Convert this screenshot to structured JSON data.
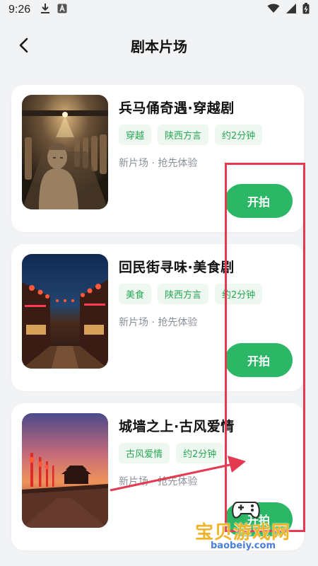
{
  "status_bar": {
    "time": "9:26"
  },
  "header": {
    "title": "剧本片场"
  },
  "cards": [
    {
      "title": "兵马俑奇遇·穿越剧",
      "tags": [
        "穿越",
        "陕西方言",
        "约2分钟"
      ],
      "meta": "新片场 · 抢先体验",
      "button": "开拍"
    },
    {
      "title": "回民街寻味·美食剧",
      "tags": [
        "美食",
        "陕西方言",
        "约2分钟"
      ],
      "meta": "新片场 · 抢先体验",
      "button": "开拍"
    },
    {
      "title": "城墙之上·古风爱情",
      "tags": [
        "古风爱情",
        "约2分钟"
      ],
      "meta": "新片场 · 抢先体验",
      "button": "开拍"
    }
  ],
  "watermark": {
    "text": "宝贝游戏网",
    "url": "baobeiy.com"
  },
  "colors": {
    "accent": "#2bb765",
    "tag_text": "#27a853",
    "tag_bg": "#eef7f0",
    "annotation": "#e53950"
  }
}
